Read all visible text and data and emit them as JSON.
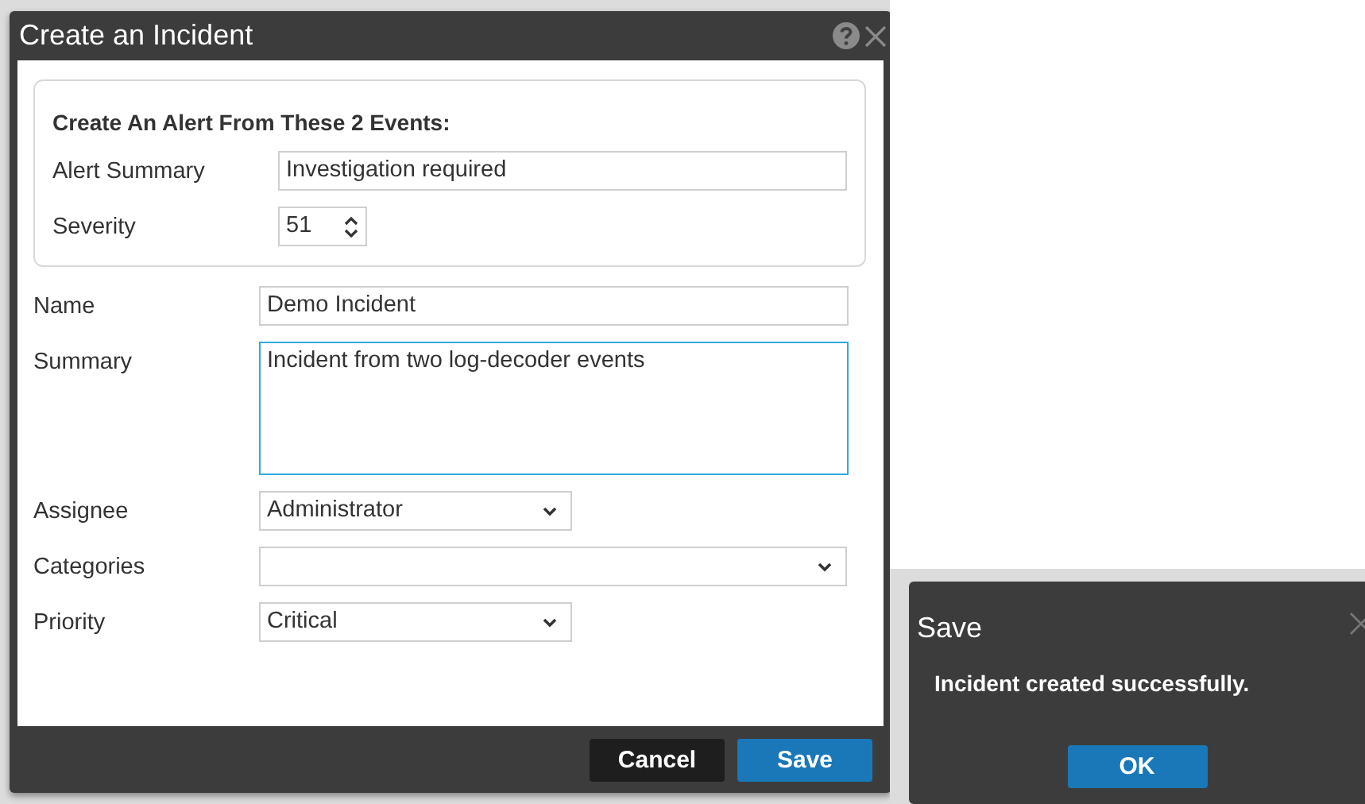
{
  "incident_dialog": {
    "title": "Create an Incident",
    "alert_group": {
      "heading": "Create An Alert From These 2 Events:",
      "fields": [
        {
          "label": "Alert Summary",
          "kind": "text",
          "value": "Investigation required"
        },
        {
          "label": "Severity",
          "kind": "spinner",
          "value": "51"
        }
      ]
    },
    "fields": [
      {
        "label": "Name",
        "kind": "text",
        "value": "Demo Incident",
        "focused": false
      },
      {
        "label": "Summary",
        "kind": "textarea",
        "value": "Incident from two log-decoder events",
        "focused": true
      },
      {
        "label": "Assignee",
        "kind": "select",
        "value": "Administrator",
        "focused": false
      },
      {
        "label": "Categories",
        "kind": "select_wide",
        "focused": false
      },
      {
        "label": "Priority",
        "kind": "select",
        "value": "Critical",
        "focused": false
      }
    ],
    "buttons": [
      {
        "label": "Cancel",
        "kind": "secondary"
      },
      {
        "label": "Save",
        "kind": "primary"
      }
    ]
  },
  "save_dialog": {
    "title": "Save",
    "message": "Incident created successfully.",
    "buttons": [
      {
        "label": "OK",
        "kind": "primary"
      }
    ]
  }
}
